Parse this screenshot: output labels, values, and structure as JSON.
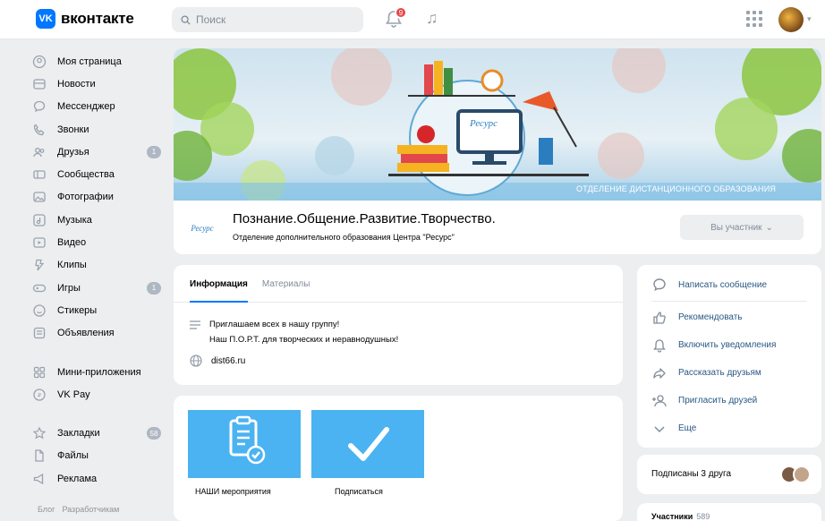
{
  "header": {
    "logo_badge": "VK",
    "logo_text": "вконтакте",
    "search_placeholder": "Поиск",
    "notifications_count": "9"
  },
  "sidebar": {
    "items": [
      {
        "label": "Моя страница",
        "icon": "user-circle-icon"
      },
      {
        "label": "Новости",
        "icon": "news-icon"
      },
      {
        "label": "Мессенджер",
        "icon": "message-icon"
      },
      {
        "label": "Звонки",
        "icon": "phone-icon"
      },
      {
        "label": "Друзья",
        "icon": "friends-icon",
        "badge": "1"
      },
      {
        "label": "Сообщества",
        "icon": "communities-icon"
      },
      {
        "label": "Фотографии",
        "icon": "photo-icon"
      },
      {
        "label": "Музыка",
        "icon": "music-icon"
      },
      {
        "label": "Видео",
        "icon": "video-icon"
      },
      {
        "label": "Клипы",
        "icon": "clips-icon"
      },
      {
        "label": "Игры",
        "icon": "gamepad-icon",
        "badge": "1"
      },
      {
        "label": "Стикеры",
        "icon": "sticker-icon"
      },
      {
        "label": "Объявления",
        "icon": "ads-icon"
      }
    ],
    "items2": [
      {
        "label": "Мини-приложения",
        "icon": "apps-icon"
      },
      {
        "label": "VK Pay",
        "icon": "vkpay-icon"
      }
    ],
    "items3": [
      {
        "label": "Закладки",
        "icon": "star-icon",
        "badge": "58"
      },
      {
        "label": "Файлы",
        "icon": "file-icon"
      },
      {
        "label": "Реклама",
        "icon": "megaphone-icon"
      }
    ],
    "footer": [
      "Блог",
      "Разработчикам"
    ]
  },
  "group": {
    "cover_caption": "ОТДЕЛЕНИЕ ДИСТАНЦИОННОГО ОБРАЗОВАНИЯ",
    "cover_logo": "Ресурс",
    "name": "Познание.Общение.Развитие.Творчество.",
    "subtitle": "Отделение дополнительного образования Центра \"Ресурс\"",
    "member_button": "Вы участник",
    "logo_text": "Ресурс"
  },
  "info": {
    "tabs": [
      "Информация",
      "Материалы"
    ],
    "description_line1": "Приглашаем всех в нашу группу!",
    "description_line2": "Наш П.О.Р.Т. для творческих и неравнодушных!",
    "site": "dist66.ru"
  },
  "tiles": [
    {
      "label": "НАШИ мероприятия",
      "icon": "clipboard-check-icon"
    },
    {
      "label": "Подписаться",
      "icon": "checkmark-icon"
    }
  ],
  "actions": [
    {
      "label": "Написать сообщение",
      "icon": "message-icon"
    },
    {
      "label": "Рекомендовать",
      "icon": "thumbs-up-icon"
    },
    {
      "label": "Включить уведомления",
      "icon": "bell-icon"
    },
    {
      "label": "Рассказать друзьям",
      "icon": "share-icon"
    },
    {
      "label": "Пригласить друзей",
      "icon": "add-user-icon"
    },
    {
      "label": "Еще",
      "icon": "chevron-down-icon"
    }
  ],
  "friends": {
    "text": "Подписаны 3 друга"
  },
  "members": {
    "label": "Участники",
    "count": "589"
  },
  "colors": {
    "accent": "#0077ff",
    "tile": "#4bb3f1",
    "link": "#2a5885"
  }
}
